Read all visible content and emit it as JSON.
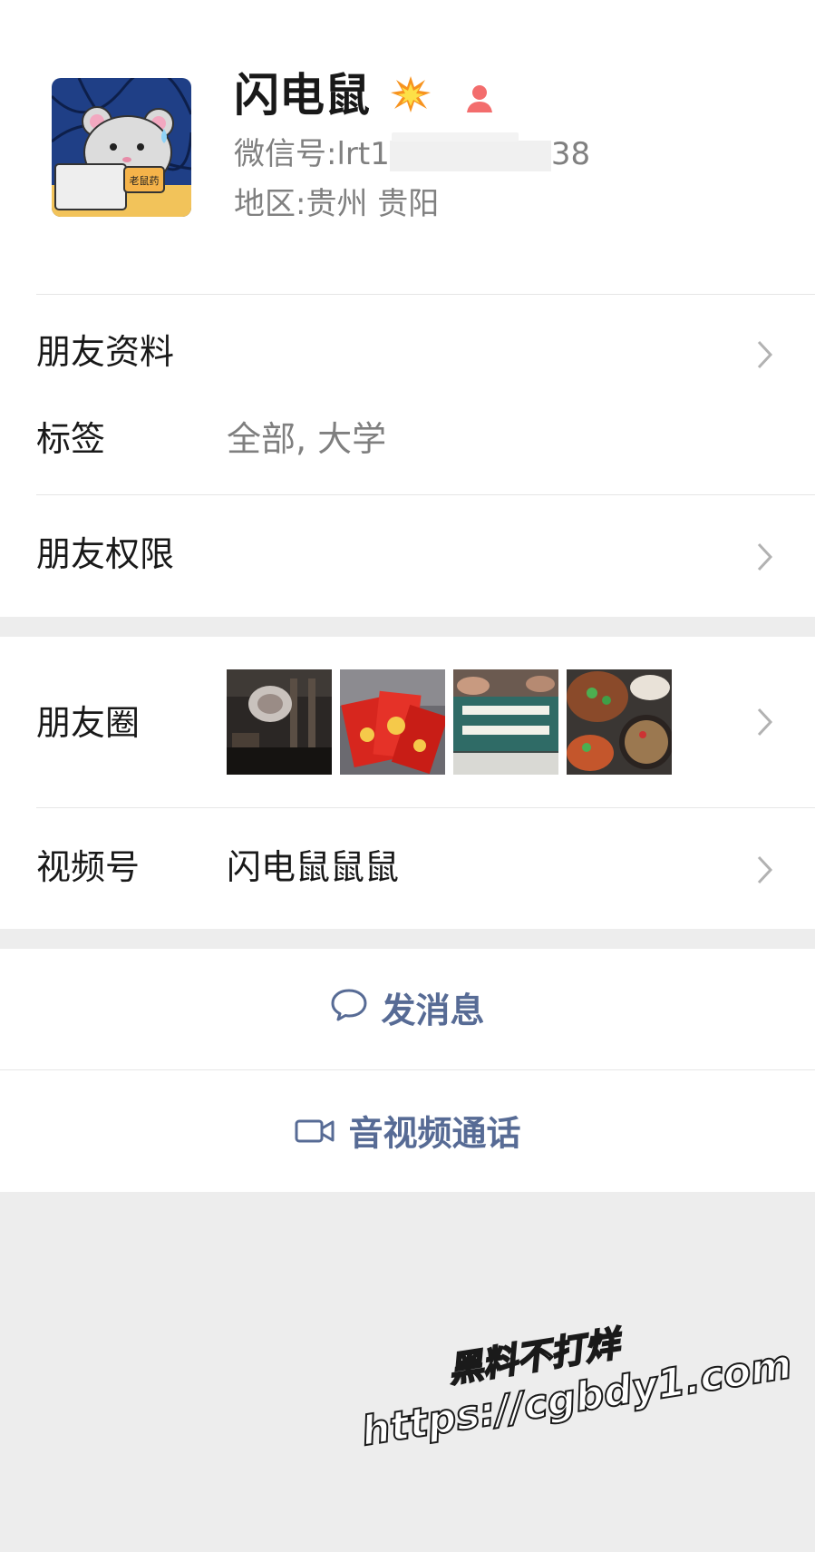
{
  "profile": {
    "name": "闪电鼠",
    "wechat_id_prefix": "微信号:lrt1",
    "wechat_id_suffix": "38",
    "region": "地区:贵州 贵阳",
    "avatar_text": "老鼠药"
  },
  "rows": {
    "friend_info": "朋友资料",
    "tags_label": "标签",
    "tags_value": "全部, 大学",
    "permissions": "朋友权限",
    "moments": "朋友圈",
    "channels_label": "视频号",
    "channels_value": "闪电鼠鼠鼠"
  },
  "actions": {
    "message": "发消息",
    "call": "音视频通话"
  },
  "watermark": {
    "line1": "黑料不打烊",
    "line2": "https://cgbdy1.com"
  },
  "colors": {
    "link": "#576b95",
    "background": "#ededed",
    "badge": "#f36d6d"
  }
}
